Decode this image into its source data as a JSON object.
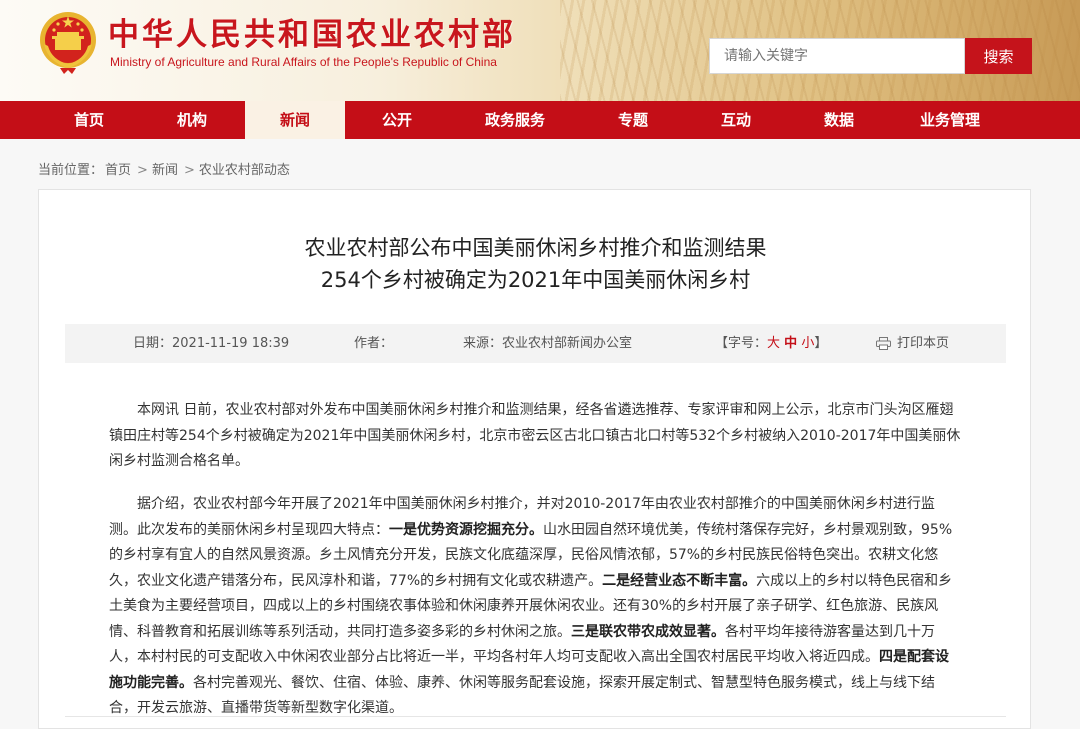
{
  "header": {
    "site_title": "中华人民共和国农业农村部",
    "site_subtitle": "Ministry of Agriculture and Rural Affairs of the People's Republic of China",
    "search_placeholder": "请输入关键字",
    "search_button": "搜索"
  },
  "nav": [
    {
      "label": "首页"
    },
    {
      "label": "机构"
    },
    {
      "label": "新闻",
      "active": true
    },
    {
      "label": "公开"
    },
    {
      "label": "政务服务"
    },
    {
      "label": "专题"
    },
    {
      "label": "互动"
    },
    {
      "label": "数据"
    },
    {
      "label": "业务管理"
    }
  ],
  "breadcrumb": {
    "prefix": "当前位置：",
    "items": [
      "首页",
      "新闻",
      "农业农村部动态"
    ],
    "separator": ">"
  },
  "article": {
    "title_line1": "农业农村部公布中国美丽休闲乡村推介和监测结果",
    "title_line2": "254个乡村被确定为2021年中国美丽休闲乡村",
    "date_label": "日期：",
    "date": "2021-11-19 18:39",
    "author_label": "作者：",
    "source_label": "来源：",
    "source": "农业农村部新闻办公室",
    "font_size_prefix": "【字号：",
    "font_size_large": "大",
    "font_size_medium": "中",
    "font_size_small": "小",
    "font_size_suffix": "】",
    "print_label": "打印本页",
    "paragraph1": "本网讯 日前，农业农村部对外发布中国美丽休闲乡村推介和监测结果，经各省遴选推荐、专家评审和网上公示，北京市门头沟区雁翅镇田庄村等254个乡村被确定为2021年中国美丽休闲乡村，北京市密云区古北口镇古北口村等532个乡村被纳入2010-2017年中国美丽休闲乡村监测合格名单。",
    "p2_a": "据介绍，农业农村部今年开展了2021年中国美丽休闲乡村推介，并对2010-2017年由农业农村部推介的中国美丽休闲乡村进行监测。此次发布的美丽休闲乡村呈现四大特点：",
    "p2_b1": "一是优势资源挖掘充分。",
    "p2_c": "山水田园自然环境优美，传统村落保存完好，乡村景观别致，95%的乡村享有宜人的自然风景资源。乡土风情充分开发，民族文化底蕴深厚，民俗风情浓郁，57%的乡村民族民俗特色突出。农耕文化悠久，农业文化遗产错落分布，民风淳朴和谐，77%的乡村拥有文化或农耕遗产。",
    "p2_b2": "二是经营业态不断丰富。",
    "p2_d": "六成以上的乡村以特色民宿和乡土美食为主要经营项目，四成以上的乡村围绕农事体验和休闲康养开展休闲农业。还有30%的乡村开展了亲子研学、红色旅游、民族风情、科普教育和拓展训练等系列活动，共同打造多姿多彩的乡村休闲之旅。",
    "p2_b3": "三是联农带农成效显著。",
    "p2_e": "各村平均年接待游客量达到几十万人，本村村民的可支配收入中休闲农业部分占比将近一半，平均各村年人均可支配收入高出全国农村居民平均收入将近四成。",
    "p2_b4": "四是配套设施功能完善。",
    "p2_f": "各村完善观光、餐饮、住宿、体验、康养、休闲等服务配套设施，探索开展定制式、智慧型特色服务模式，线上与线下结合，开发云旅游、直播带货等新型数字化渠道。"
  },
  "colors": {
    "brand_red": "#c40e17",
    "nav_active_bg": "#faf1e4",
    "meta_bg": "#f3f3f3"
  }
}
